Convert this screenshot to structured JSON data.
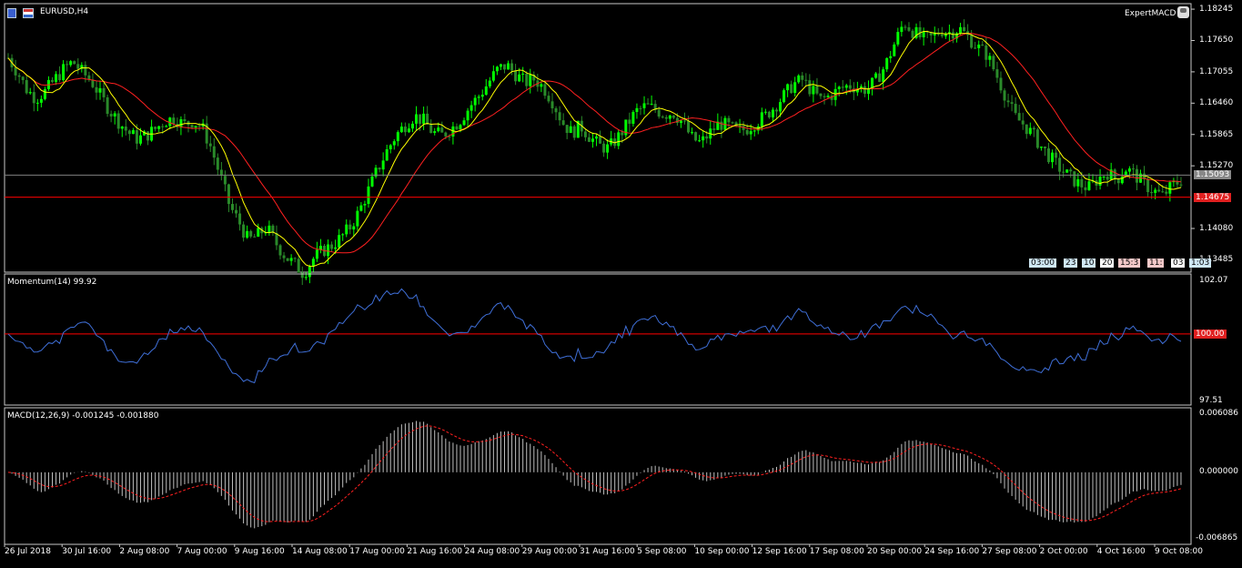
{
  "symbol_title": "EURUSD,H4",
  "expert_name": "ExpertMACD",
  "price_axis": [
    "1.18245",
    "1.17650",
    "1.17055",
    "1.16460",
    "1.15865",
    "1.15270",
    "1.14080",
    "1.13485"
  ],
  "current_bid": "1.15093",
  "level_line": "1.14675",
  "momentum": {
    "title": "Momentum(14) 99.92",
    "top": "102.07",
    "bottom": "97.51",
    "level": "100.00"
  },
  "macd": {
    "title": "MACD(12,26,9) -0.001245 -0.001880",
    "top": "0.006086",
    "zero": "0.000000",
    "bottom": "-0.006865"
  },
  "time_badges": [
    {
      "text": "03:00",
      "color": "#cfe8f5"
    },
    {
      "text": "23",
      "color": "#cfe8f5"
    },
    {
      "text": "10",
      "color": "#cfe8f5"
    },
    {
      "text": "20",
      "color": "#ffffff"
    },
    {
      "text": "15:3",
      "color": "#f5c9c9"
    },
    {
      "text": "11:",
      "color": "#f5c9c9"
    },
    {
      "text": "03",
      "color": "#ffffff"
    },
    {
      "text": "1:03",
      "color": "#cfe8f5"
    }
  ],
  "dates": [
    "26 Jul 2018",
    "30 Jul 16:00",
    "2 Aug 08:00",
    "7 Aug 00:00",
    "9 Aug 16:00",
    "14 Aug 08:00",
    "17 Aug 00:00",
    "21 Aug 16:00",
    "24 Aug 08:00",
    "29 Aug 00:00",
    "31 Aug 16:00",
    "5 Sep 08:00",
    "10 Sep 00:00",
    "12 Sep 16:00",
    "17 Sep 08:00",
    "20 Sep 00:00",
    "24 Sep 16:00",
    "27 Sep 08:00",
    "2 Oct 00:00",
    "4 Oct 16:00",
    "9 Oct 08:00"
  ],
  "colors": {
    "bull": "#00ff00",
    "bear": "#2a8a2a",
    "ma_fast": "#ffff00",
    "ma_slow": "#ff2020",
    "momentum": "#3f6fd8",
    "macd_hist": "#c0c0c0",
    "macd_signal": "#ff2020",
    "bid_line": "#808080",
    "level_line": "#ff0000"
  },
  "chart_data": {
    "type": "line",
    "symbol": "EURUSD",
    "timeframe": "H4",
    "price_ylim": [
      1.1325,
      1.1835
    ],
    "price_path": [
      1.1732,
      1.1705,
      1.1672,
      1.1655,
      1.1668,
      1.169,
      1.171,
      1.1725,
      1.1705,
      1.1688,
      1.166,
      1.1632,
      1.161,
      1.159,
      1.1578,
      1.1585,
      1.1598,
      1.1612,
      1.1618,
      1.1605,
      1.1612,
      1.16,
      1.156,
      1.1505,
      1.145,
      1.142,
      1.1385,
      1.1395,
      1.141,
      1.138,
      1.1355,
      1.134,
      1.1322,
      1.135,
      1.1365,
      1.1375,
      1.139,
      1.141,
      1.144,
      1.148,
      1.152,
      1.1555,
      1.1585,
      1.1605,
      1.1622,
      1.1612,
      1.159,
      1.1585,
      1.1598,
      1.1615,
      1.164,
      1.166,
      1.1685,
      1.171,
      1.1718,
      1.17,
      1.1685,
      1.1692,
      1.1675,
      1.1648,
      1.161,
      1.159,
      1.1602,
      1.1582,
      1.1565,
      1.156,
      1.158,
      1.1605,
      1.163,
      1.164,
      1.1635,
      1.1625,
      1.1628,
      1.161,
      1.158,
      1.157,
      1.159,
      1.1608,
      1.1602,
      1.1592,
      1.1598,
      1.161,
      1.1622,
      1.164,
      1.166,
      1.1682,
      1.169,
      1.167,
      1.1652,
      1.166,
      1.1672,
      1.168,
      1.1676,
      1.1672,
      1.169,
      1.1718,
      1.176,
      1.18,
      1.1782,
      1.1768,
      1.177,
      1.1785,
      1.178,
      1.1788,
      1.177,
      1.1752,
      1.1738,
      1.17,
      1.166,
      1.162,
      1.1605,
      1.1585,
      1.156,
      1.154,
      1.152,
      1.1505,
      1.1492,
      1.1485,
      1.1502,
      1.1515,
      1.15,
      1.1522,
      1.151,
      1.1492,
      1.148,
      1.147,
      1.1488,
      1.15
    ],
    "momentum_ylim": [
      97.51,
      102.07
    ],
    "momentum_level": 100.0,
    "macd_ylim": [
      -0.006865,
      0.006086
    ],
    "series": [
      {
        "name": "MACD(12,26,9)",
        "last": -0.001245
      },
      {
        "name": "Signal",
        "last": -0.00188
      },
      {
        "name": "Momentum(14)",
        "last": 99.92
      }
    ]
  }
}
